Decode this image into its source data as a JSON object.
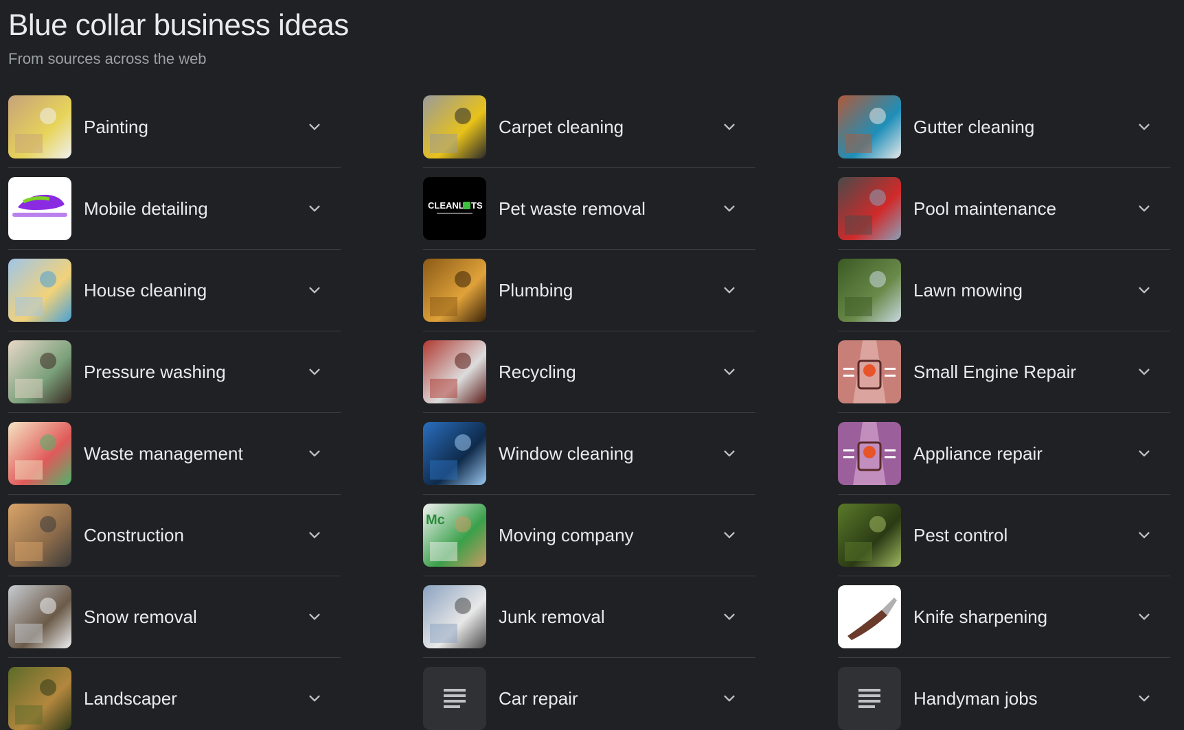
{
  "header": {
    "title": "Blue collar business ideas",
    "subtitle": "From sources across the web"
  },
  "columns": [
    {
      "items": [
        {
          "label": "Painting",
          "icon": "painting-photo",
          "colors": [
            "#c7a27a",
            "#e7d45a",
            "#f0f0f0"
          ]
        },
        {
          "label": "Mobile detailing",
          "icon": "auto-easy-detailing-logo",
          "colors": [
            "#ffffff",
            "#8a2be2",
            "#7ed321"
          ]
        },
        {
          "label": "House cleaning",
          "icon": "house-cleaning-photo",
          "colors": [
            "#9fc5e8",
            "#f2d27a",
            "#4aa0d5"
          ]
        },
        {
          "label": "Pressure washing",
          "icon": "pressure-washing-photo",
          "colors": [
            "#e8d8c8",
            "#7aa07a",
            "#3a2a22"
          ]
        },
        {
          "label": "Waste management",
          "icon": "waste-management-illustration",
          "colors": [
            "#f4e3c2",
            "#e05a5a",
            "#4fb36b"
          ]
        },
        {
          "label": "Construction",
          "icon": "construction-photo",
          "colors": [
            "#d9a468",
            "#8c6b4a",
            "#3a3a3a"
          ]
        },
        {
          "label": "Snow removal",
          "icon": "snow-removal-photo",
          "colors": [
            "#c8ccd2",
            "#6b5a48",
            "#eef0f3"
          ]
        },
        {
          "label": "Landscaper",
          "icon": "landscaper-photo",
          "colors": [
            "#5c6b2a",
            "#b3873e",
            "#2f3a18"
          ]
        }
      ]
    },
    {
      "items": [
        {
          "label": "Carpet cleaning",
          "icon": "carpet-cleaning-photo",
          "colors": [
            "#9a9a9a",
            "#e8c21a",
            "#2a2a2a"
          ]
        },
        {
          "label": "Pet waste removal",
          "icon": "cleanlots-logo",
          "colors": [
            "#000000",
            "#ffffff",
            "#3fbf3f"
          ],
          "logo_text": "CLEANL",
          "logo_text2": "TS"
        },
        {
          "label": "Plumbing",
          "icon": "plumbing-photo",
          "colors": [
            "#8a5a16",
            "#e0a23a",
            "#3a2208"
          ]
        },
        {
          "label": "Recycling",
          "icon": "recycling-photo",
          "colors": [
            "#b03a32",
            "#dcdcdc",
            "#5a1c18"
          ]
        },
        {
          "label": "Window cleaning",
          "icon": "window-cleaning-photo",
          "colors": [
            "#2a6fbf",
            "#0f2a4a",
            "#9bc7ef"
          ]
        },
        {
          "label": "Moving company",
          "icon": "moving-company-photo",
          "colors": [
            "#f2f2f2",
            "#3aa04a",
            "#c89a62"
          ],
          "logo_text": "Mc"
        },
        {
          "label": "Junk removal",
          "icon": "junk-removal-photo",
          "colors": [
            "#8aa2c0",
            "#e8e8e8",
            "#4a4a4a"
          ]
        },
        {
          "label": "Car repair",
          "icon": "article-icon",
          "colors": [
            "#303134",
            "#bdc1c6"
          ]
        }
      ]
    },
    {
      "items": [
        {
          "label": "Gutter cleaning",
          "icon": "gutter-cleaning-photo",
          "colors": [
            "#b05a3a",
            "#1e8fb8",
            "#e8e8e8"
          ]
        },
        {
          "label": "Pool maintenance",
          "icon": "pool-maintenance-photo",
          "colors": [
            "#4a4a4a",
            "#d02a2a",
            "#8aa0b8"
          ]
        },
        {
          "label": "Lawn mowing",
          "icon": "lawn-mowing-photo",
          "colors": [
            "#3a5a24",
            "#6a8a4a",
            "#c8d8e0"
          ]
        },
        {
          "label": "Small Engine Repair",
          "icon": "engine-repair-illustration",
          "colors": [
            "#c77f78",
            "#f3d2cc",
            "#e8542a"
          ]
        },
        {
          "label": "Appliance repair",
          "icon": "appliance-repair-illustration",
          "colors": [
            "#9b5f9b",
            "#f0c8e8",
            "#e8542a"
          ]
        },
        {
          "label": "Pest control",
          "icon": "pest-control-photo",
          "colors": [
            "#5a7a2a",
            "#2a3a14",
            "#a0b860"
          ]
        },
        {
          "label": "Knife sharpening",
          "icon": "knife-photo",
          "colors": [
            "#ffffff",
            "#6a3a2a",
            "#b0b0b0"
          ]
        },
        {
          "label": "Handyman jobs",
          "icon": "article-icon",
          "colors": [
            "#303134",
            "#bdc1c6"
          ]
        }
      ]
    }
  ],
  "expand_icon": "chevron-down-icon"
}
